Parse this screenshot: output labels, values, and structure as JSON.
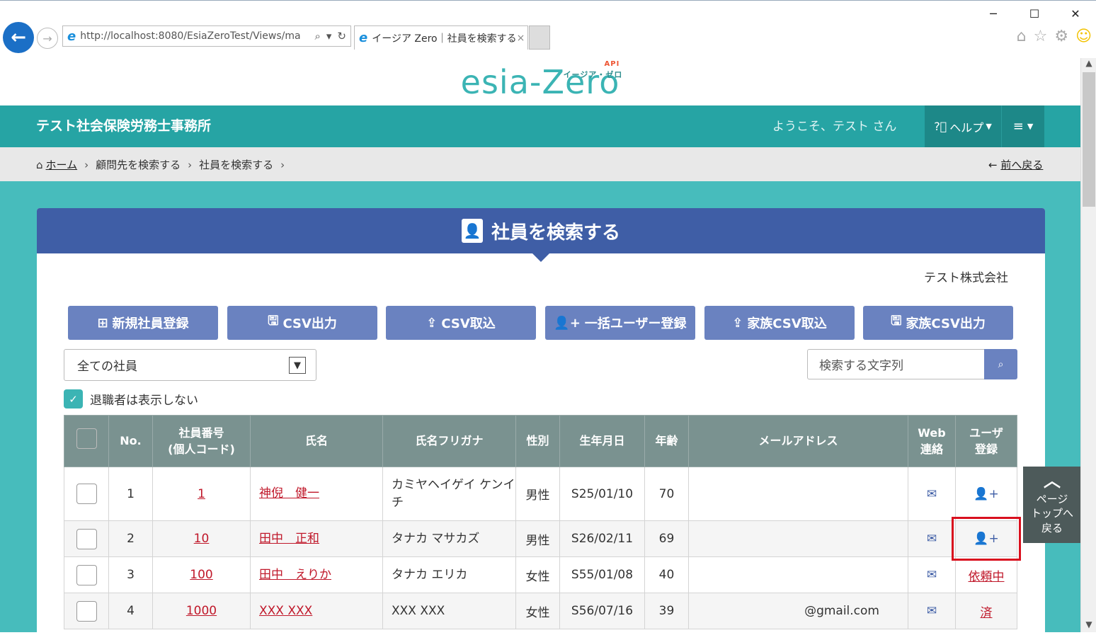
{
  "browser": {
    "url": "http://localhost:8080/EsiaZeroTest/Views/ma",
    "tab_title": "イージア Zero｜社員を検索する",
    "tab_close": "×",
    "win_minimize": "─",
    "win_maximize": "☐",
    "win_close": "✕"
  },
  "logo": {
    "main": "esia-Zero",
    "sub": "イージア・ゼロ",
    "api": "API"
  },
  "topbar": {
    "office_name": "テスト社会保険労務士事務所",
    "welcome": "ようこそ、テスト さん",
    "help_label": "ヘルプ",
    "menu_label": "≡"
  },
  "breadcrumb": {
    "home": "ホーム",
    "items": [
      "顧問先を検索する",
      "社員を検索する"
    ],
    "back": "前へ戻る"
  },
  "panel": {
    "title": "社員を検索する",
    "company": "テスト株式会社"
  },
  "actions": [
    {
      "label": "新規社員登録",
      "icon": "plus-square-icon"
    },
    {
      "label": "CSV出力",
      "icon": "save-icon"
    },
    {
      "label": "CSV取込",
      "icon": "upload-icon"
    },
    {
      "label": "一括ユーザー登録",
      "icon": "user-plus-icon"
    },
    {
      "label": "家族CSV取込",
      "icon": "upload-icon"
    },
    {
      "label": "家族CSV出力",
      "icon": "save-icon"
    }
  ],
  "filter": {
    "selected": "全ての社員"
  },
  "search": {
    "placeholder": "検索する文字列"
  },
  "retired": {
    "label": "退職者は表示しない",
    "checked": true
  },
  "table": {
    "headers": {
      "no": "No.",
      "emp_no_1": "社員番号",
      "emp_no_2": "(個人コード)",
      "name": "氏名",
      "kana": "氏名フリガナ",
      "gender": "性別",
      "birth": "生年月日",
      "age": "年齢",
      "email": "メールアドレス",
      "web_1": "Web",
      "web_2": "連絡",
      "user_1": "ユーザ",
      "user_2": "登録"
    },
    "rows": [
      {
        "no": "1",
        "emp_no": "1",
        "name": "神倪　健一",
        "kana": "カミヤヘイゲイ ケンイチ",
        "gender": "男性",
        "birth": "S25/01/10",
        "age": "70",
        "email": "",
        "user_status": ""
      },
      {
        "no": "2",
        "emp_no": "10",
        "name": "田中　正和",
        "kana": "タナカ マサカズ",
        "gender": "男性",
        "birth": "S26/02/11",
        "age": "69",
        "email": "",
        "user_status": ""
      },
      {
        "no": "3",
        "emp_no": "100",
        "name": "田中　えりか",
        "kana": "タナカ エリカ",
        "gender": "女性",
        "birth": "S55/01/08",
        "age": "40",
        "email": "",
        "user_status": "依頼中"
      },
      {
        "no": "4",
        "emp_no": "1000",
        "name": "XXX XXX",
        "kana": "XXX XXX",
        "gender": "女性",
        "birth": "S56/07/16",
        "age": "39",
        "email": "@gmail.com",
        "user_status": "済"
      }
    ]
  },
  "page_top": {
    "line1": "ページ",
    "line2": "トップへ",
    "line3": "戻る"
  },
  "colors": {
    "teal": "#26a4a4",
    "panel_header": "#3f5ea6",
    "button": "#6a82c0",
    "link_red": "#c0182a"
  }
}
